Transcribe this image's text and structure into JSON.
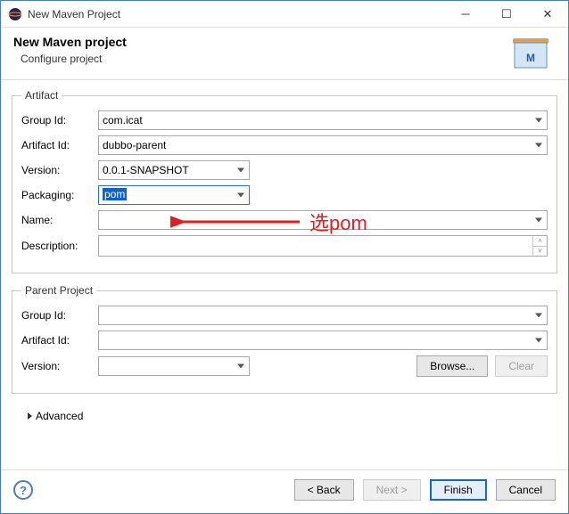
{
  "titlebar": {
    "title": "New Maven Project"
  },
  "header": {
    "title": "New Maven project",
    "subtitle": "Configure project"
  },
  "artifact": {
    "legend": "Artifact",
    "group_id_label": "Group Id:",
    "group_id": "com.icat",
    "artifact_id_label": "Artifact Id:",
    "artifact_id": "dubbo-parent",
    "version_label": "Version:",
    "version": "0.0.1-SNAPSHOT",
    "packaging_label": "Packaging:",
    "packaging": "pom",
    "name_label": "Name:",
    "name": "",
    "description_label": "Description:",
    "description": ""
  },
  "parent": {
    "legend": "Parent Project",
    "group_id_label": "Group Id:",
    "group_id": "",
    "artifact_id_label": "Artifact Id:",
    "artifact_id": "",
    "version_label": "Version:",
    "version": "",
    "browse_label": "Browse...",
    "clear_label": "Clear"
  },
  "advanced_label": "Advanced",
  "footer": {
    "back": "< Back",
    "next": "Next >",
    "finish": "Finish",
    "cancel": "Cancel"
  },
  "annotation": "选pom"
}
